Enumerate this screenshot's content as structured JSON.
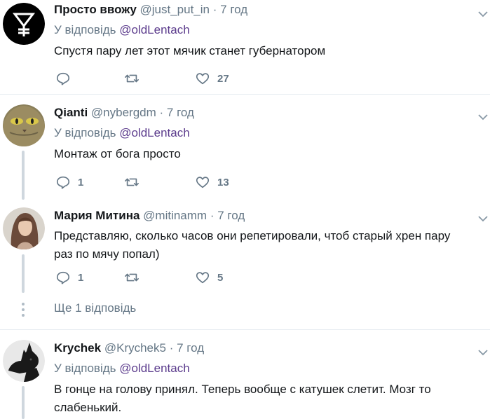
{
  "tweets": [
    {
      "name": "Просто ввожу",
      "handle": "@just_put_in",
      "separator": "·",
      "time": "7 год",
      "reply_prefix": "У відповідь",
      "reply_mention": "@oldLentach",
      "text": "Спустя пару лет этот мячик станет губернатором",
      "replies": "",
      "retweets": "",
      "likes": "27",
      "avatar": "y-logo-avatar"
    },
    {
      "name": "Qianti",
      "handle": "@nybergdm",
      "separator": "·",
      "time": "7 год",
      "reply_prefix": "У відповідь",
      "reply_mention": "@oldLentach",
      "text": "Монтаж от бога просто",
      "replies": "1",
      "retweets": "",
      "likes": "13",
      "avatar": "cat-avatar"
    },
    {
      "name": "Мария Митина",
      "handle": "@mitinamm",
      "separator": "·",
      "time": "7 год",
      "text": "Представляю, сколько часов они репетировали, чтоб старый хрен пару раз по мячу попал)",
      "replies": "1",
      "retweets": "",
      "likes": "5",
      "avatar": "woman-avatar"
    },
    {
      "name": "Krychek",
      "handle": "@Krychek5",
      "separator": "·",
      "time": "7 год",
      "reply_prefix": "У відповідь",
      "reply_mention": "@oldLentach",
      "text": "В гонце на голову принял. Теперь вообще с катушек слетит. Мозг то слабенький.",
      "avatar": "dog-avatar"
    }
  ],
  "more_replies_label": "Ще 1 відповідь",
  "colors": {
    "text": "#14171a",
    "secondary": "#657786",
    "mention": "#5b3b8c",
    "thread_line": "#cfd7de",
    "divider": "#e6ecf0"
  }
}
